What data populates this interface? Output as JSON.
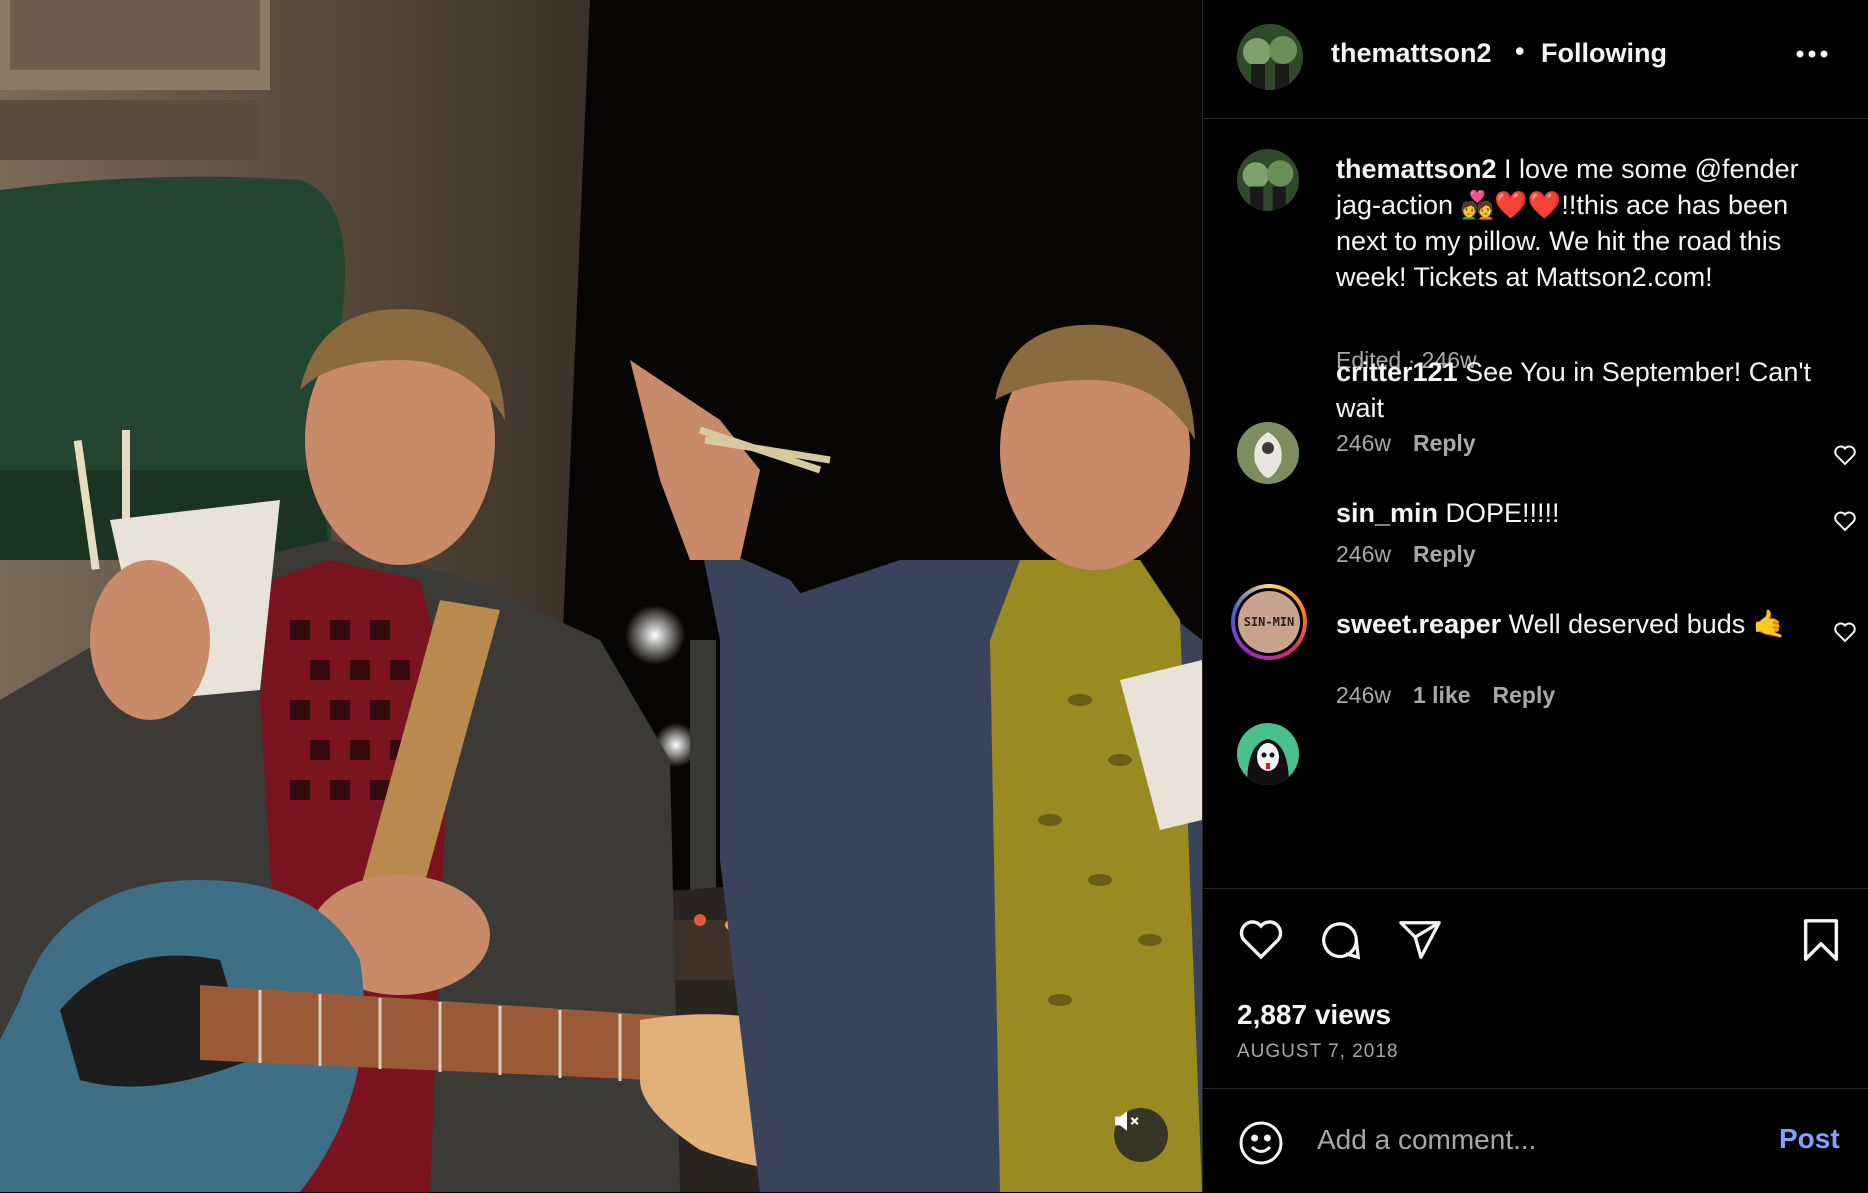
{
  "post": {
    "username": "themattson2",
    "separator": "•",
    "follow_status": "Following",
    "more_icon": "more-horizontal-icon"
  },
  "caption": {
    "username": "themattson2",
    "text": " I love me some ",
    "mention": "@fender",
    "text2": " jag-action 💑❤️❤️!!this ace has been next to my pillow. We hit the road this week! Tickets at Mattson2.com!",
    "edited": "Edited",
    "meta_sep": " · ",
    "age": "246w"
  },
  "comments": [
    {
      "username": "critter121",
      "text": " See You in September! Can't wait",
      "age": "246w",
      "likes": "",
      "reply": "Reply"
    },
    {
      "username": "sin_min",
      "text": " DOPE!!!!!",
      "age": "246w",
      "likes": "",
      "reply": "Reply",
      "avatar_text": "SIN-MIN"
    },
    {
      "username": "sweet.reaper",
      "text": " Well deserved buds 🤙",
      "age": "246w",
      "likes": "1 like",
      "reply": "Reply"
    }
  ],
  "stats": {
    "views": "2,887 views",
    "date": "AUGUST 7, 2018"
  },
  "comment_box": {
    "placeholder": "Add a comment...",
    "post_label": "Post"
  },
  "colors": {
    "background": "#000000",
    "text": "#f5f5f5",
    "secondary": "#a8a8a8",
    "link": "#85a1ff",
    "divider": "#262626"
  }
}
